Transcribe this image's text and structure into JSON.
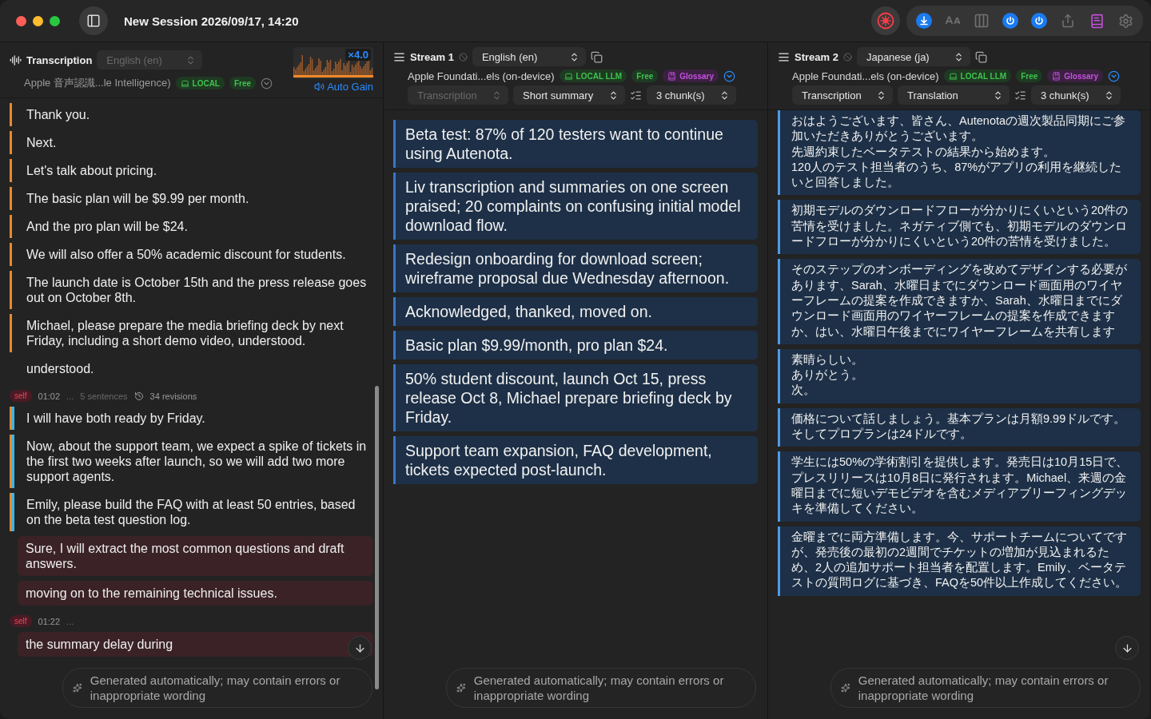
{
  "window": {
    "title": "New Session 2026/09/17, 14:20"
  },
  "toolbar": [
    {
      "kind": "download",
      "on": true
    },
    {
      "kind": "text_size",
      "on": false
    },
    {
      "kind": "columns",
      "on": false
    },
    {
      "kind": "power",
      "on": true
    },
    {
      "kind": "power",
      "on": true
    },
    {
      "kind": "share",
      "on": false
    },
    {
      "kind": "book",
      "on": true
    },
    {
      "kind": "settings",
      "on": false
    }
  ],
  "transcription": {
    "title": "Transcription",
    "language": "English (en)",
    "language_disabled": true,
    "model": "Apple 音声認識...le Intelligence)",
    "badges": [
      {
        "kind": "local",
        "label": "LOCAL"
      },
      {
        "kind": "free",
        "label": "Free"
      }
    ],
    "gain": "×4.0",
    "auto_gain": "Auto Gain",
    "entries": [
      {
        "kind": "line",
        "text": "Thank you."
      },
      {
        "kind": "line",
        "text": "Next."
      },
      {
        "kind": "line",
        "text": "Let's talk about pricing."
      },
      {
        "kind": "line",
        "text": "The basic plan will be $9.99 per month."
      },
      {
        "kind": "line",
        "text": "And the pro plan will be $24."
      },
      {
        "kind": "line",
        "text": "We will also offer a 50% academic discount for students."
      },
      {
        "kind": "line",
        "text": "The launch date is October 15th and the press release goes out on October 8th."
      },
      {
        "kind": "line",
        "text": "Michael, please prepare the media briefing deck by next Friday, including a short demo video, understood."
      },
      {
        "kind": "plain",
        "text": "understood."
      },
      {
        "kind": "meta",
        "speaker": "self",
        "time": "01:02",
        "more": "...",
        "sentences": "5 sentences",
        "revisions": "34 revisions"
      },
      {
        "kind": "revised",
        "text": "I will have both ready by Friday."
      },
      {
        "kind": "revised",
        "text": "Now, about the support team, we expect a spike of tickets in the first two weeks after launch, so we will add two more support agents."
      },
      {
        "kind": "revised",
        "text": "Emily, please build the FAQ with at least 50 entries, based on the beta test question log."
      },
      {
        "kind": "live",
        "text": "Sure, I will extract the most common questions and draft answers."
      },
      {
        "kind": "live",
        "text": "moving on to the remaining technical issues."
      },
      {
        "kind": "meta",
        "speaker": "self",
        "time": "01:22",
        "more": "..."
      },
      {
        "kind": "live",
        "text": "the summary delay during"
      }
    ],
    "footer": "Generated automatically; may contain errors or inappropriate wording"
  },
  "streams": [
    {
      "kind": "summary",
      "title": "Stream 1",
      "language": "English (en)",
      "model": "Apple Foundati...els (on-device)",
      "badges": [
        {
          "kind": "local",
          "label": "LOCAL LLM"
        },
        {
          "kind": "free",
          "label": "Free"
        },
        {
          "kind": "glossary",
          "label": "Glossary"
        }
      ],
      "source": "Transcription",
      "source_disabled": true,
      "mode": "Short summary",
      "chunks": "3 chunk(s)",
      "cards": [
        {
          "lines": [
            "Beta test: 87% of 120 testers want to continue using Autenota."
          ]
        },
        {
          "lines": [
            "Liv transcription and summaries on one screen praised; 20 complaints on confusing initial model download flow."
          ]
        },
        {
          "lines": [
            "Redesign onboarding for download screen; wireframe proposal due Wednesday afternoon."
          ]
        },
        {
          "lines": [
            "Acknowledged, thanked, moved on."
          ]
        },
        {
          "lines": [
            "Basic plan $9.99/month, pro plan $24."
          ]
        },
        {
          "lines": [
            "50% student discount, launch Oct 15, press release Oct 8, Michael prepare briefing deck by Friday."
          ]
        },
        {
          "lines": [
            "Support team expansion, FAQ development, tickets expected post-launch."
          ]
        }
      ],
      "footer": "Generated automatically; may contain errors or inappropriate wording"
    },
    {
      "kind": "translation",
      "title": "Stream 2",
      "language": "Japanese (ja)",
      "model": "Apple Foundati...els (on-device)",
      "badges": [
        {
          "kind": "local",
          "label": "LOCAL LLM"
        },
        {
          "kind": "free",
          "label": "Free"
        },
        {
          "kind": "glossary",
          "label": "Glossary"
        }
      ],
      "source": "Transcription",
      "source_disabled": false,
      "mode": "Translation",
      "chunks": "3 chunk(s)",
      "cards": [
        {
          "lines": [
            "おはようございます、皆さん、Autenotaの週次製品同期にご参加いただきありがとうございます。",
            "先週約束したベータテストの結果から始めます。",
            "120人のテスト担当者のうち、87%がアプリの利用を継続したいと回答しました。"
          ]
        },
        {
          "lines": [
            "初期モデルのダウンロードフローが分かりにくいという20件の苦情を受けました。ネガティブ側でも、初期モデルのダウンロードフローが分かりにくいという20件の苦情を受けました。"
          ]
        },
        {
          "lines": [
            "そのステップのオンボーディングを改めてデザインする必要があります、Sarah、水曜日までにダウンロード画面用のワイヤーフレームの提案を作成できますか、Sarah、水曜日までにダウンロード画面用のワイヤーフレームの提案を作成できますか、はい、水曜日午後までにワイヤーフレームを共有します"
          ]
        },
        {
          "lines": [
            "素晴らしい。",
            "ありがとう。",
            "次。"
          ]
        },
        {
          "lines": [
            "価格について話しましょう。基本プランは月額9.99ドルです。そしてプロプランは24ドルです。"
          ]
        },
        {
          "lines": [
            "学生には50%の学術割引を提供します。発売日は10月15日で、プレスリリースは10月8日に発行されます。Michael、来週の金曜日までに短いデモビデオを含むメディアブリーフィングデッキを準備してください。"
          ]
        },
        {
          "lines": [
            "金曜までに両方準備します。今、サポートチームについてですが、発売後の最初の2週間でチケットの増加が見込まれるため、2人の追加サポート担当者を配置します。Emily、ベータテストの質問ログに基づき、FAQを50件以上作成してください。"
          ]
        }
      ],
      "footer": "Generated automatically; may contain errors or inappropriate wording"
    }
  ]
}
